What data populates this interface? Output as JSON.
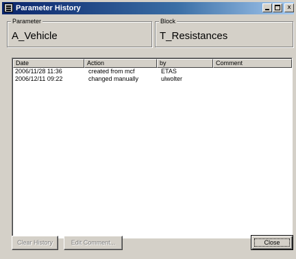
{
  "window": {
    "title": "Parameter History",
    "controls": {
      "minimize_icon": "minimize-icon",
      "maximize_icon": "maximize-icon",
      "close_glyph": "x"
    }
  },
  "parameter_group": {
    "legend": "Parameter",
    "value": "A_Vehicle"
  },
  "block_group": {
    "legend": "Block",
    "value": "T_Resistances"
  },
  "history_table": {
    "columns": [
      "Date",
      "Action",
      "by",
      "Comment"
    ],
    "rows": [
      {
        "date": "2006/11/28  11:36",
        "action": "created from mcf",
        "by": "ETAS",
        "comment": ""
      },
      {
        "date": "2006/12/11  09:22",
        "action": "changed manually",
        "by": "ulwolter",
        "comment": ""
      }
    ]
  },
  "buttons": {
    "clear_history": "Clear History",
    "edit_comment": "Edit Comment...",
    "close": "Close"
  },
  "colors": {
    "titlebar_start": "#0a246a",
    "titlebar_end": "#a6caf0",
    "window_face": "#d4d0c8"
  }
}
